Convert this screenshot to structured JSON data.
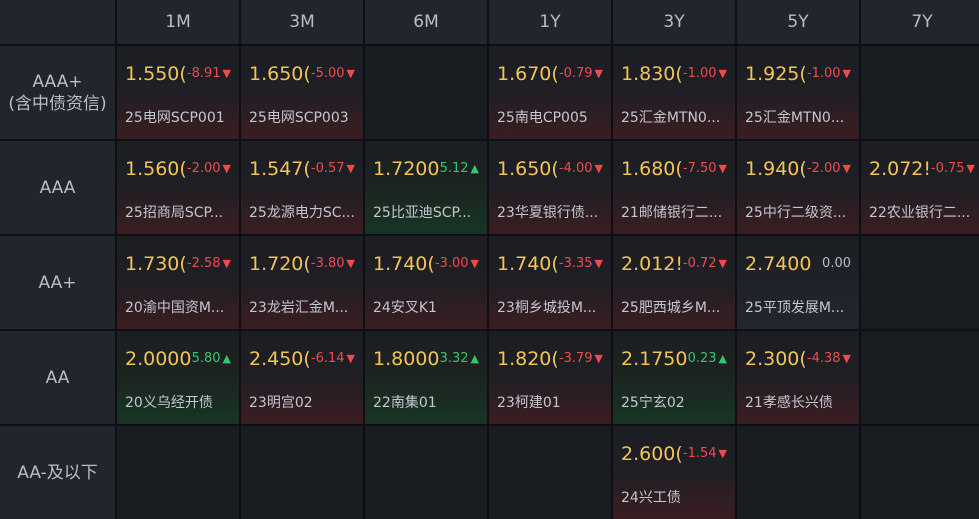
{
  "columns": [
    "1M",
    "3M",
    "6M",
    "1Y",
    "3Y",
    "5Y",
    "7Y"
  ],
  "rows": [
    {
      "label": "AAA+\n(含中债资信)",
      "cells": [
        {
          "rate": "1.550(",
          "change": "-8.91",
          "dir": "down",
          "name": "25电网SCP001"
        },
        {
          "rate": "1.650(",
          "change": "-5.00",
          "dir": "down",
          "name": "25电网SCP003"
        },
        null,
        {
          "rate": "1.670(",
          "change": "-0.79",
          "dir": "down",
          "name": "25南电CP005"
        },
        {
          "rate": "1.830(",
          "change": "-1.00",
          "dir": "down",
          "name": "25汇金MTN0..."
        },
        {
          "rate": "1.925(",
          "change": "-1.00",
          "dir": "down",
          "name": "25汇金MTN0..."
        },
        null
      ]
    },
    {
      "label": "AAA",
      "cells": [
        {
          "rate": "1.560(",
          "change": "-2.00",
          "dir": "down",
          "name": "25招商局SCP..."
        },
        {
          "rate": "1.547(",
          "change": "-0.57",
          "dir": "down",
          "name": "25龙源电力SC..."
        },
        {
          "rate": "1.7200",
          "change": "5.12",
          "dir": "up",
          "name": "25比亚迪SCP..."
        },
        {
          "rate": "1.650(",
          "change": "-4.00",
          "dir": "down",
          "name": "23华夏银行债..."
        },
        {
          "rate": "1.680(",
          "change": "-7.50",
          "dir": "down",
          "name": "21邮储银行二..."
        },
        {
          "rate": "1.940(",
          "change": "-2.00",
          "dir": "down",
          "name": "25中行二级资..."
        },
        {
          "rate": "2.072!",
          "change": "-0.75",
          "dir": "down",
          "name": "22农业银行二..."
        }
      ]
    },
    {
      "label": "AA+",
      "cells": [
        {
          "rate": "1.730(",
          "change": "-2.58",
          "dir": "down",
          "name": "20渝中国资M..."
        },
        {
          "rate": "1.720(",
          "change": "-3.80",
          "dir": "down",
          "name": "23龙岩汇金M..."
        },
        {
          "rate": "1.740(",
          "change": "-3.00",
          "dir": "down",
          "name": "24安叉K1"
        },
        {
          "rate": "1.740(",
          "change": "-3.35",
          "dir": "down",
          "name": "23桐乡城投M..."
        },
        {
          "rate": "2.012!",
          "change": "-0.72",
          "dir": "down",
          "name": "25肥西城乡M..."
        },
        {
          "rate": "2.7400",
          "change": "0.00",
          "dir": "flat",
          "name": "25平顶发展M..."
        },
        null
      ]
    },
    {
      "label": "AA",
      "cells": [
        {
          "rate": "2.0000",
          "change": "5.80",
          "dir": "up",
          "name": "20义乌经开债"
        },
        {
          "rate": "2.450(",
          "change": "-6.14",
          "dir": "down",
          "name": "23明宫02"
        },
        {
          "rate": "1.8000",
          "change": "3.32",
          "dir": "up",
          "name": "22南集01"
        },
        {
          "rate": "1.820(",
          "change": "-3.79",
          "dir": "down",
          "name": "23柯建01"
        },
        {
          "rate": "2.1750",
          "change": "0.23",
          "dir": "up",
          "name": "25宁玄02"
        },
        {
          "rate": "2.300(",
          "change": "-4.38",
          "dir": "down",
          "name": "21孝感长兴债"
        },
        null
      ]
    },
    {
      "label": "AA-及以下",
      "cells": [
        null,
        null,
        null,
        null,
        {
          "rate": "2.600(",
          "change": "-1.54",
          "dir": "down",
          "name": "24兴工债"
        },
        null,
        null
      ]
    }
  ],
  "colors": {
    "rate": "#f3c455",
    "down": "#ef4b4b",
    "up": "#35c66e",
    "header_bg": "#22262c",
    "page_bg": "#0d0f12"
  }
}
